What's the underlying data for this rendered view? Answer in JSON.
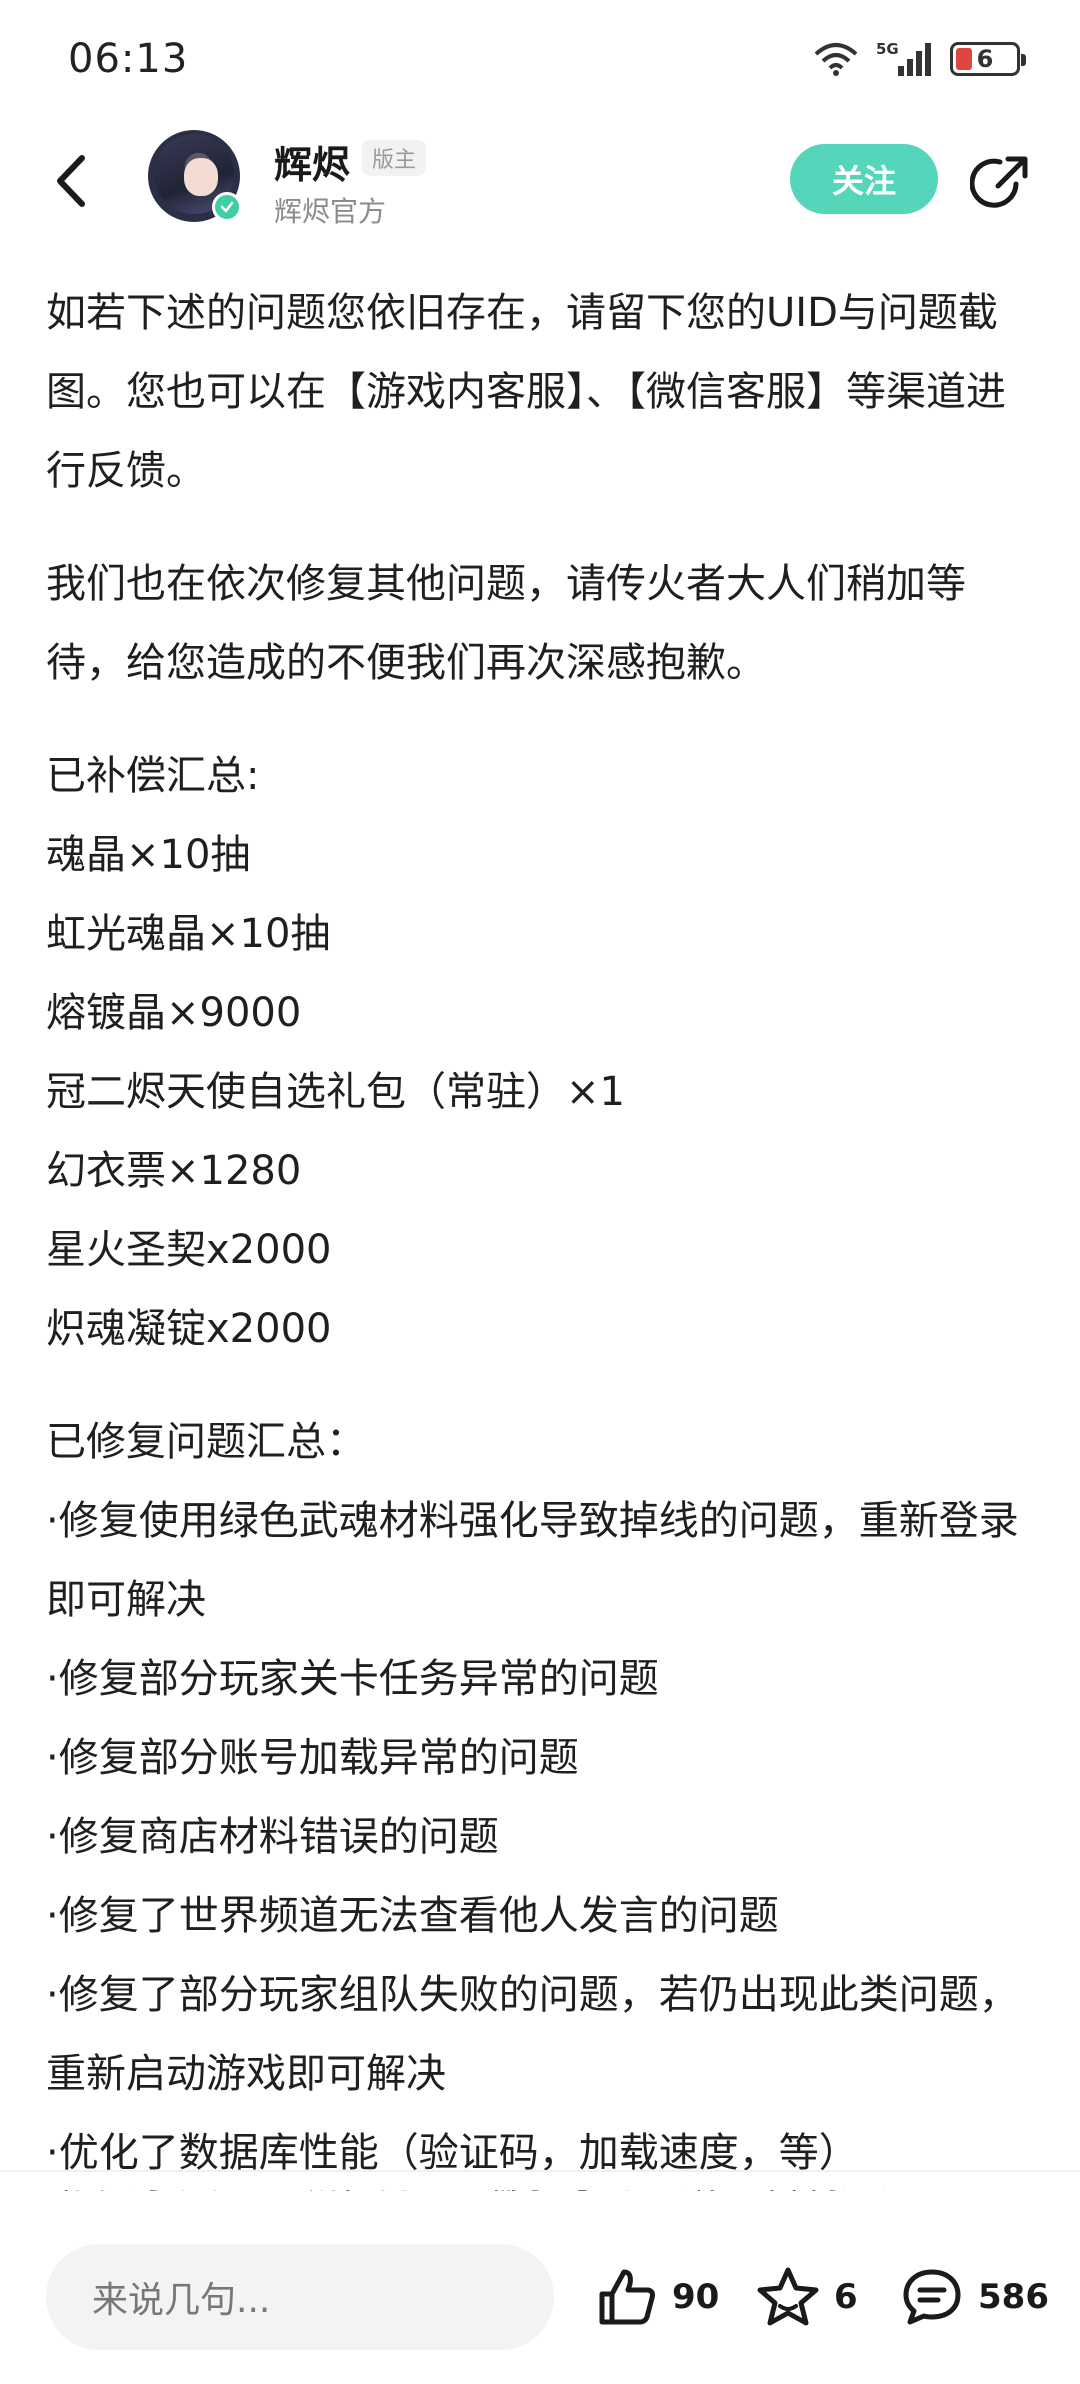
{
  "status_bar": {
    "time": "06:13",
    "network": "5G",
    "battery_level": "6"
  },
  "header": {
    "user_name": "辉烬",
    "role_badge": "版主",
    "subtitle": "辉烬官方",
    "follow_label": "关注"
  },
  "post": {
    "paragraph1": "如若下述的问题您依旧存在，请留下您的UID与问题截图。您也可以在【游戏内客服】、【微信客服】等渠道进行反馈。",
    "paragraph2": "我们也在依次修复其他问题，请传火者大人们稍加等待，给您造成的不便我们再次深感抱歉。",
    "compensation_title": "已补偿汇总:",
    "compensation_items": [
      "魂晶×10抽",
      "虹光魂晶×10抽",
      "熔镀晶×9000",
      "冠二烬天使自选礼包（常驻）×1",
      "幻衣票×1280",
      "星火圣契x2000",
      "炽魂凝锭x2000"
    ],
    "fixes_title": "已修复问题汇总：",
    "fix_items": [
      "·修复使用绿色武魂材料强化导致掉线的问题，重新登录即可解决",
      "·修复部分玩家关卡任务异常的问题",
      "·修复部分账号加载异常的问题",
      "·修复商店材料错误的问题",
      "·修复了世界频道无法查看他人发言的问题",
      "·修复了部分玩家组队失败的问题，若仍出现此类问题，重新启动游戏即可解决",
      "·优化了数据库性能（验证码，加载速度，等）"
    ],
    "partial_line": "·修复了天空之城任务“塞瑞尔号海查斯”“石制娃娃”"
  },
  "bottom_bar": {
    "comment_placeholder": "来说几句...",
    "like_count": "90",
    "favorite_count": "6",
    "comment_count": "586"
  },
  "colors": {
    "accent": "#55d6bb",
    "verified": "#3ecfa5",
    "battery_low": "#e0453e"
  }
}
